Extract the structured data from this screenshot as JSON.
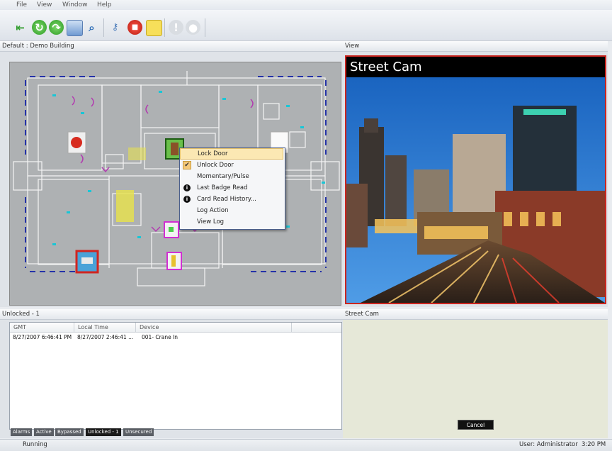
{
  "menu": {
    "file": "File",
    "view": "View",
    "window": "Window",
    "help": "Help"
  },
  "toolbar": {
    "icons": [
      "exit-icon",
      "refresh-icon",
      "forward-icon",
      "monitor-icon",
      "search-icon",
      "key-icon",
      "stop-icon",
      "note-icon",
      "disabled-icon",
      "disabled-icon"
    ]
  },
  "floorplan": {
    "header": "Default : Demo Building"
  },
  "context_menu": {
    "items": [
      {
        "label": "Lock Door"
      },
      {
        "label": "Unlock Door"
      },
      {
        "label": "Momentary/Pulse"
      },
      {
        "label": "Last Badge Read"
      },
      {
        "label": "Card Read History..."
      },
      {
        "label": "Log Action"
      },
      {
        "label": "View Log"
      }
    ]
  },
  "view_panel": {
    "header": "View",
    "camera_title": "Street Cam"
  },
  "events_panel": {
    "header": "Unlocked - 1",
    "columns": [
      "GMT",
      "Local Time",
      "Device"
    ],
    "rows": [
      {
        "gmt": "8/27/2007 6:46:41 PM",
        "local": "8/27/2007 2:46:41 ...",
        "device": "001- Crane In"
      }
    ],
    "tabs": [
      "Alarms",
      "Active",
      "Bypassed",
      "Unlocked - 1",
      "Unsecured"
    ],
    "active_tab": "Unlocked - 1"
  },
  "cam_panel": {
    "header": "Street Cam",
    "cancel_label": "Cancel"
  },
  "status": {
    "left": "Running",
    "user": "User: Administrator",
    "time": "3:20 PM"
  },
  "colors": {
    "highlight": "#fbe8b3",
    "camera_border": "#c92520",
    "plan_bg": "#aeb1b3"
  }
}
